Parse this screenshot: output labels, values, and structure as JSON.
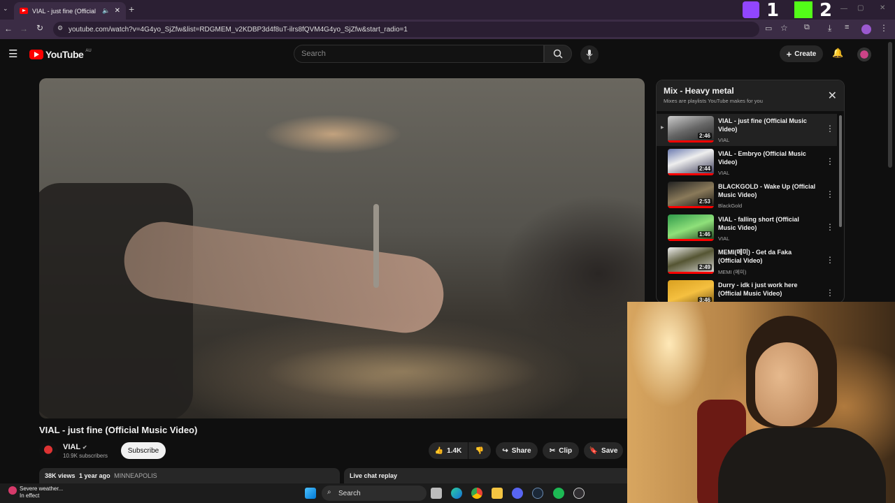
{
  "browser": {
    "tab_title": "VIAL - just fine (Official Mu",
    "new_tab": "+",
    "url": "youtube.com/watch?v=4G4yo_SjZfw&list=RDGMEM_v2KDBP3d4f8uT-ilrs8fQVM4G4yo_SjZfw&start_radio=1",
    "overlay_numbers": [
      "1",
      "2"
    ]
  },
  "youtube": {
    "logo_text": "YouTube",
    "region": "AU",
    "search_placeholder": "Search",
    "create_label": "Create"
  },
  "video": {
    "title": "VIAL - just fine (Official Music Video)",
    "channel_name": "VIAL",
    "subscribers": "10.9K subscribers",
    "subscribe_label": "Subscribe",
    "likes": "1.4K",
    "share_label": "Share",
    "clip_label": "Clip",
    "save_label": "Save",
    "views": "38K views",
    "age": "1 year ago",
    "location": "MINNEAPOLIS",
    "chat_replay": "Live chat replay"
  },
  "playlist": {
    "title": "Mix - Heavy metal",
    "subtitle": "Mixes are playlists YouTube makes for you",
    "items": [
      {
        "title": "VIAL - just fine (Official Music Video)",
        "channel": "VIAL",
        "duration": "2:46"
      },
      {
        "title": "VIAL - Embryo (Official Music Video)",
        "channel": "VIAL",
        "duration": "2:44"
      },
      {
        "title": "BLACKGOLD - Wake Up (Official Music Video)",
        "channel": "BlackGold",
        "duration": "2:53"
      },
      {
        "title": "VIAL - falling short (Official Music Video)",
        "channel": "VIAL",
        "duration": "1:46"
      },
      {
        "title": "MEMI(메미) - Get da Faka (Official Video)",
        "channel": "MEMI (메미)",
        "duration": "2:49"
      },
      {
        "title": "Durry - idk i just work here (Official Music Video)",
        "channel": "",
        "duration": "3:46"
      }
    ]
  },
  "taskbar": {
    "weather_line1": "Severe weather...",
    "weather_line2": "In effect",
    "search_label": "Search"
  },
  "colors": {
    "youtube_red": "#ff0000",
    "background": "#0f0f0f",
    "tab_bar": "#2b1f33",
    "twitch_purple": "#9146ff",
    "kick_green": "#53fc18"
  }
}
